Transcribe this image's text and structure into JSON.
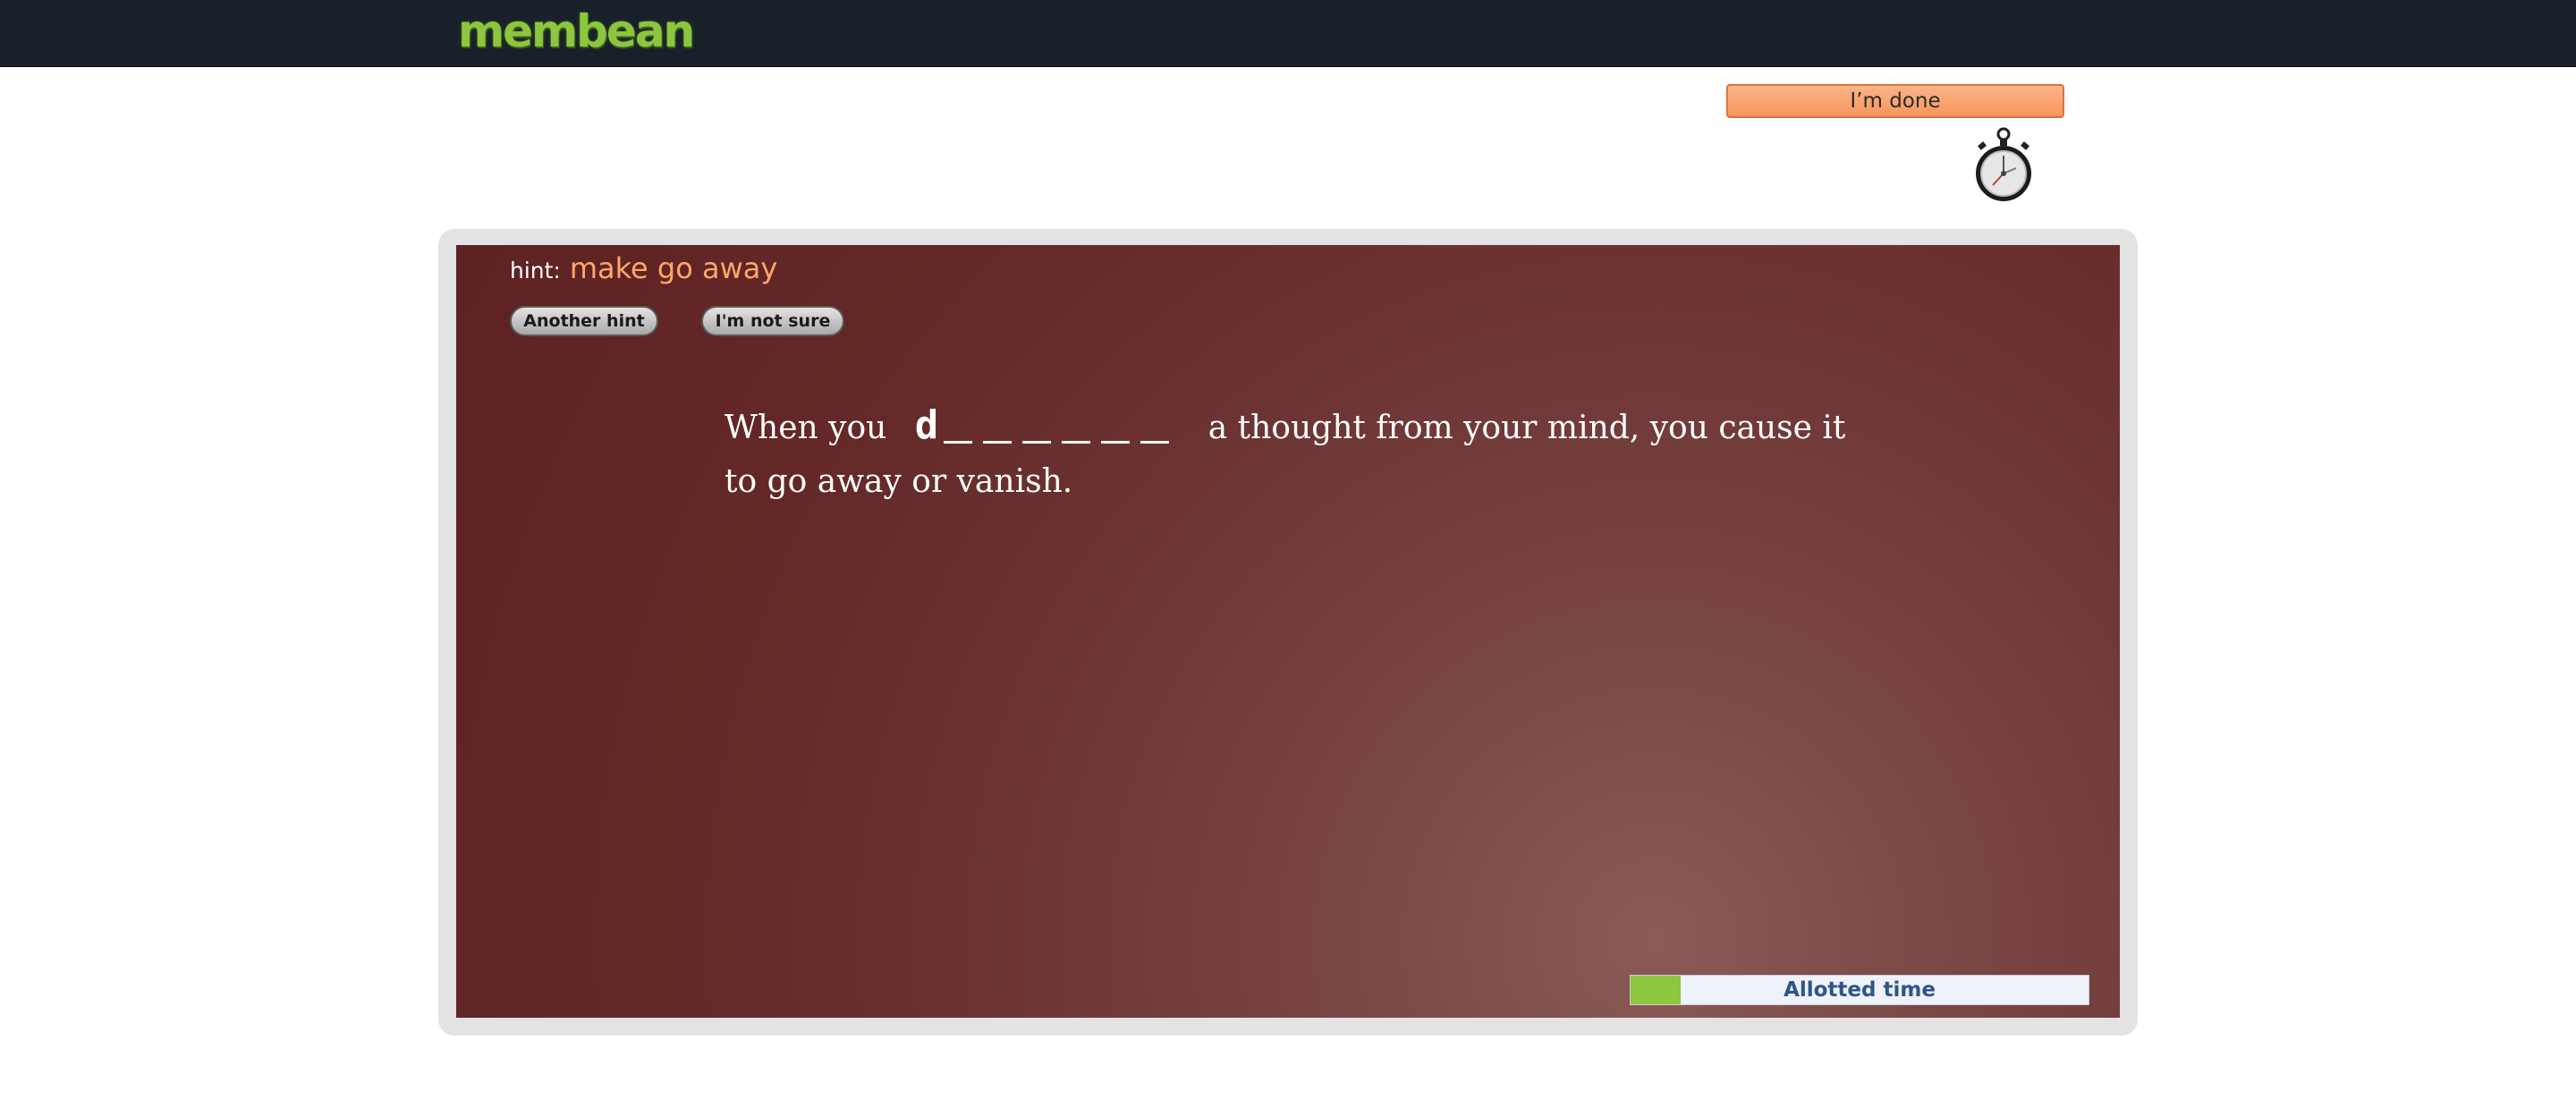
{
  "header": {
    "logo_text": "membean"
  },
  "done_button": {
    "label": "I’m done"
  },
  "hint": {
    "label": "hint:",
    "text": "make go away"
  },
  "buttons": {
    "another_hint": "Another hint",
    "not_sure": "I'm not sure"
  },
  "question": {
    "before": "When you",
    "letter": "d",
    "blank_count": 6,
    "after": "a thought from your mind, you cause it to go away or vanish."
  },
  "timer": {
    "label": "Allotted time",
    "progress_fraction": 0.11
  },
  "icons": {
    "stopwatch": "stopwatch-icon"
  },
  "colors": {
    "accent_green": "#8dc63f",
    "hint_orange": "#ffa66b",
    "done_orange": "#f7955c",
    "panel_maroon": "#632827"
  }
}
